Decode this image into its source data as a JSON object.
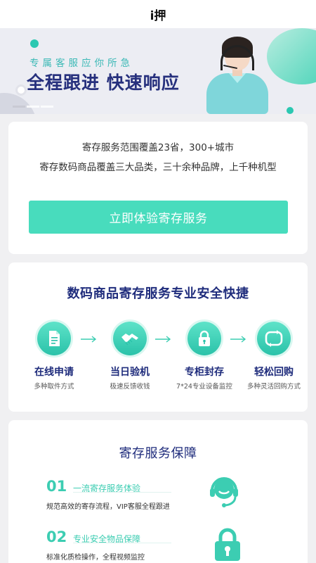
{
  "app": {
    "title": "i押"
  },
  "banner": {
    "subtitle": "专属客服应你所急",
    "headline": "全程跟进  快速响应",
    "slides": 3,
    "active_slide": 1
  },
  "intro": {
    "line1": "寄存服务范围覆盖23省，300+城市",
    "line2": "寄存数码商品覆盖三大品类，三十余种品牌，上千种机型",
    "cta_label": "立即体验寄存服务"
  },
  "process": {
    "heading": "数码商品寄存服务专业安全快捷",
    "steps": [
      {
        "icon": "document-icon",
        "name": "在线申请",
        "desc": "多种取件方式"
      },
      {
        "icon": "handshake-icon",
        "name": "当日验机",
        "desc": "极速反馈收钱"
      },
      {
        "icon": "lock-icon",
        "name": "专柜封存",
        "desc": "7*24专业设备监控"
      },
      {
        "icon": "refresh-icon",
        "name": "轻松回购",
        "desc": "多种灵活回购方式"
      }
    ]
  },
  "guarantee": {
    "heading": "寄存服务保障",
    "features": [
      {
        "num": "01",
        "title": "一流寄存服务体验",
        "desc": "规范高效的寄存流程，VIP客服全程跟进",
        "icon": "headset-icon"
      },
      {
        "num": "02",
        "title": "专业安全物品保障",
        "desc": "标准化质检操作，全程视频监控",
        "icon": "padlock-icon"
      }
    ]
  },
  "colors": {
    "accent": "#48dcbd",
    "navy": "#1f2c7c",
    "teal_text": "#3ccdb2"
  }
}
